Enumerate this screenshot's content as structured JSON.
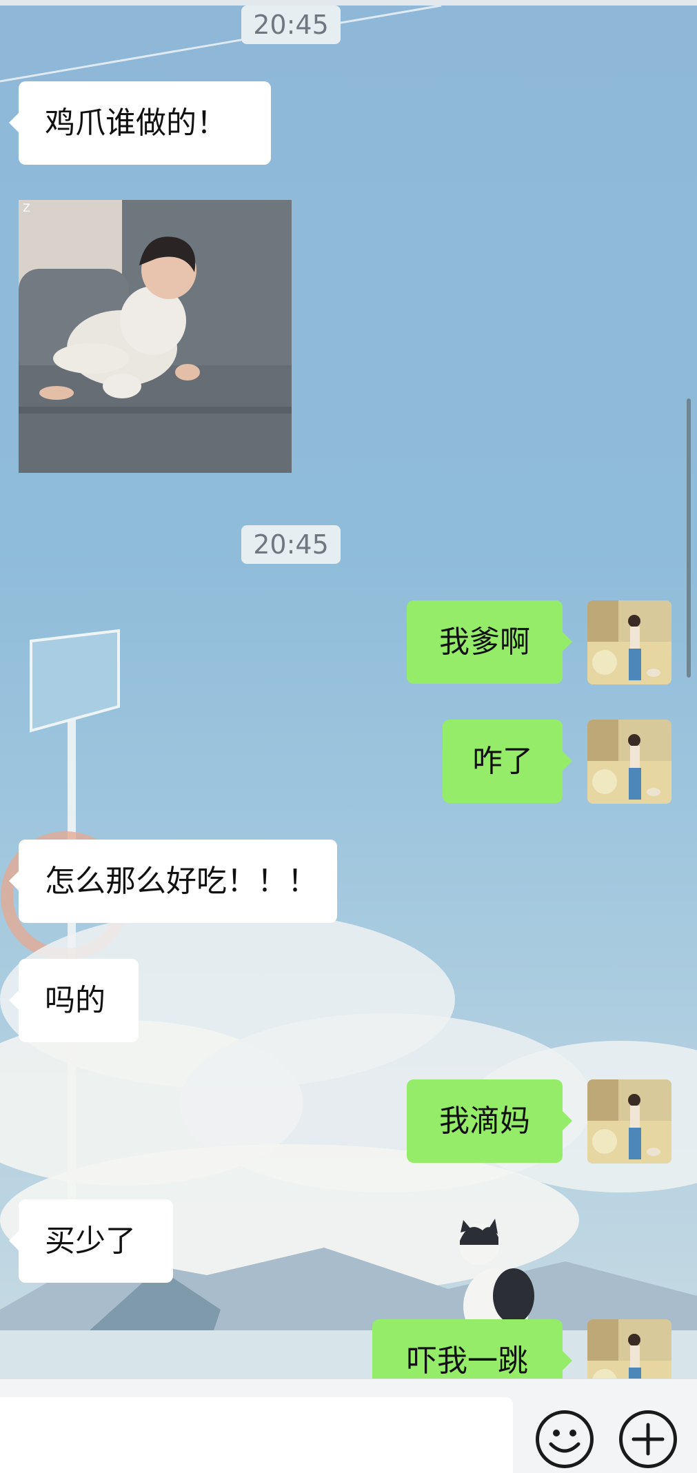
{
  "chat": {
    "messages": [
      {
        "type": "timestamp",
        "text": "20:45"
      },
      {
        "type": "text",
        "side": "received",
        "text": "鸡爪谁做的！"
      },
      {
        "type": "image",
        "side": "received",
        "description_icon": "baby-on-sofa-photo",
        "corner_label": "Z"
      },
      {
        "type": "timestamp",
        "text": "20:45"
      },
      {
        "type": "text",
        "side": "sent",
        "text": "我爹啊"
      },
      {
        "type": "text",
        "side": "sent",
        "text": "咋了"
      },
      {
        "type": "text",
        "side": "received",
        "text": "怎么那么好吃！！！"
      },
      {
        "type": "text",
        "side": "received",
        "text": "吗的"
      },
      {
        "type": "text",
        "side": "sent",
        "text": "我滴妈"
      },
      {
        "type": "text",
        "side": "received",
        "text": "买少了"
      },
      {
        "type": "text",
        "side": "sent",
        "text": "吓我一跳"
      }
    ]
  },
  "input_bar": {
    "value": "",
    "icons": [
      "emoji-icon",
      "plus-icon"
    ]
  },
  "colors": {
    "sent_bubble": "#95ec69",
    "received_bubble": "#ffffff",
    "timestamp_bg": "#e6eef2",
    "chat_bg": "#8fb8d8"
  }
}
